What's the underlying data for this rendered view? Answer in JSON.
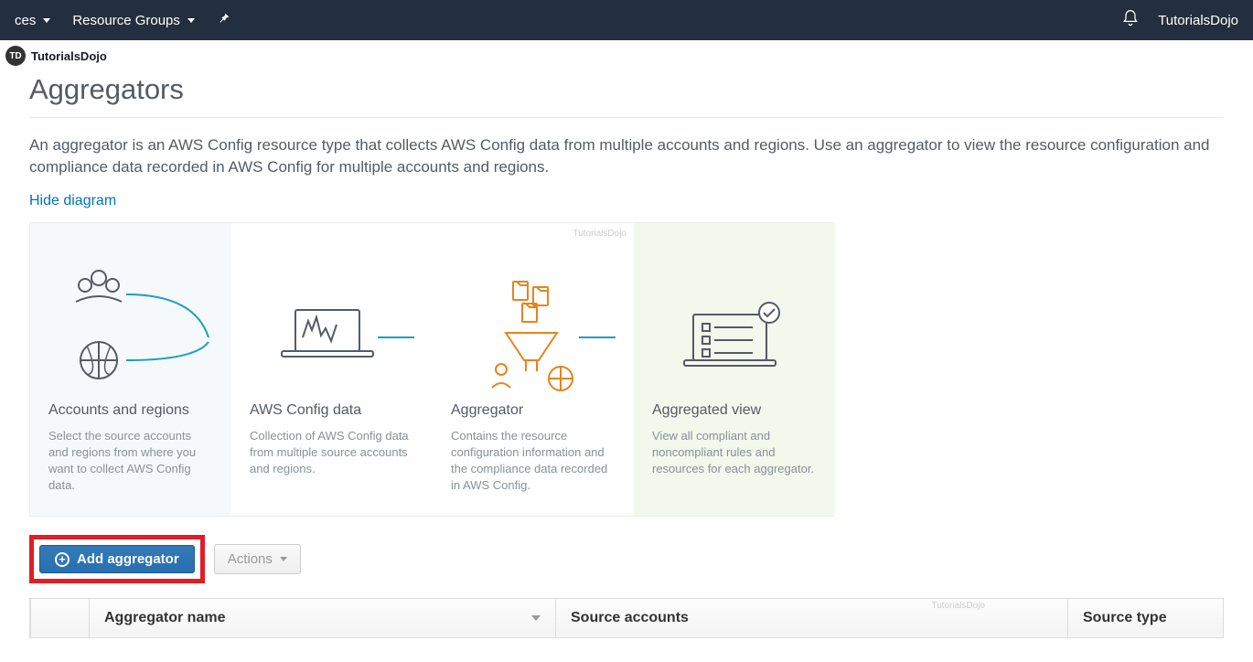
{
  "header": {
    "nav_left_item1": "ces",
    "nav_resource_groups": "Resource Groups",
    "account_label": "TutorialsDojo"
  },
  "watermark": {
    "badge": "TD",
    "text": "TutorialsDojo"
  },
  "page": {
    "title": "Aggregators",
    "intro": "An aggregator is an AWS Config resource type that collects AWS Config data from multiple accounts and regions. Use an aggregator to view the resource configuration and compliance data recorded in AWS Config for multiple accounts and regions.",
    "hide_diagram": "Hide diagram"
  },
  "diagram": {
    "panels": [
      {
        "title": "Accounts and regions",
        "desc": "Select the source accounts and regions from where you want to collect AWS Config data."
      },
      {
        "title": "AWS Config data",
        "desc": "Collection of AWS Config data from multiple source accounts and regions."
      },
      {
        "title": "Aggregator",
        "desc": "Contains the resource configuration information and the compliance data recorded in AWS Config."
      },
      {
        "title": "Aggregated view",
        "desc": "View all compliant and noncompliant rules and resources for each aggregator."
      }
    ],
    "wm": "TutorialsDojo"
  },
  "buttons": {
    "add_aggregator": "Add aggregator",
    "actions": "Actions"
  },
  "table": {
    "columns": {
      "name": "Aggregator name",
      "source_accounts": "Source accounts",
      "source_type": "Source type"
    },
    "wm": "TutorialsDojo"
  }
}
